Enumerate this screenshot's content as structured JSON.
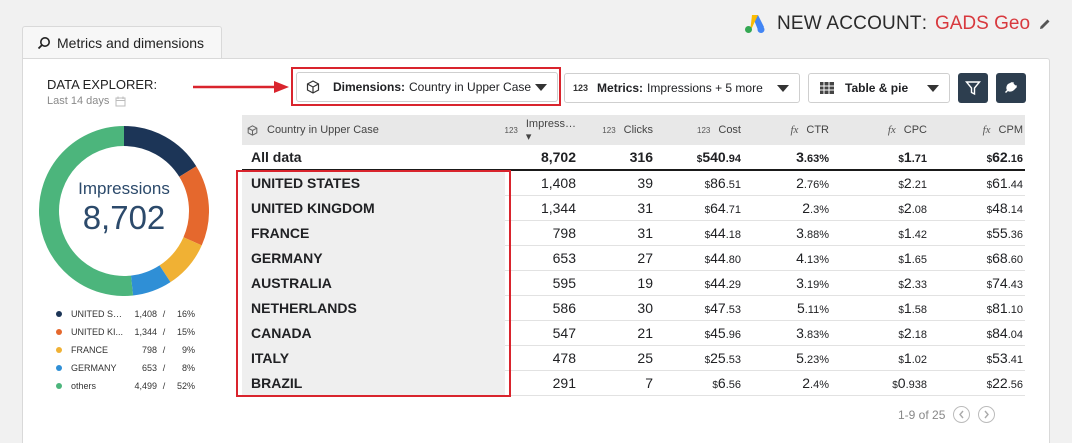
{
  "header": {
    "account_label": "NEW ACCOUNT",
    "colon": ":",
    "account_name": "GADS Geo",
    "colors": {
      "account_name": "#d8393e"
    }
  },
  "tab": {
    "label": "Metrics and dimensions"
  },
  "explorer": {
    "title": "DATA EXPLORER:",
    "date_range": "Last 14 days"
  },
  "toolbar": {
    "dimensions": {
      "prefix": "Dimensions:",
      "value": "Country in Upper Case"
    },
    "metrics": {
      "icon_text": "123",
      "prefix": "Metrics:",
      "value": "Impressions + 5 more"
    },
    "view": {
      "value": "Table & pie"
    },
    "highlight_color": "#d9242d"
  },
  "donut": {
    "label": "Impressions",
    "total": "8,702",
    "segments": [
      {
        "name": "UNITED ST...",
        "value": 1408,
        "value_text": "1,408",
        "pct": "16%",
        "color": "#1c3557"
      },
      {
        "name": "UNITED KI...",
        "value": 1344,
        "value_text": "1,344",
        "pct": "15%",
        "color": "#e5682d"
      },
      {
        "name": "FRANCE",
        "value": 798,
        "value_text": "798",
        "pct": "9%",
        "color": "#f0b134"
      },
      {
        "name": "GERMANY",
        "value": 653,
        "value_text": "653",
        "pct": "8%",
        "color": "#2f8fd6"
      },
      {
        "name": "others",
        "value": 4499,
        "value_text": "4,499",
        "pct": "52%",
        "color": "#4cb57c"
      }
    ]
  },
  "table": {
    "columns": [
      {
        "label": "Country in Upper Case",
        "prefix": ""
      },
      {
        "label": "Impress… ▾",
        "prefix": "123"
      },
      {
        "label": "Clicks",
        "prefix": "123"
      },
      {
        "label": "Cost",
        "prefix": "123"
      },
      {
        "label": "CTR",
        "prefix": "fx"
      },
      {
        "label": "CPC",
        "prefix": "fx"
      },
      {
        "label": "CPM",
        "prefix": "fx"
      }
    ],
    "total_row": {
      "name": "All data",
      "impressions": "8,702",
      "clicks": "316",
      "cost_int": "540",
      "cost_dec": ".94",
      "ctr_int": "3",
      "ctr_dec": ".63%",
      "cpc_int": "1",
      "cpc_dec": ".71",
      "cpm_int": "62",
      "cpm_dec": ".16"
    },
    "rows": [
      {
        "name": "UNITED STATES",
        "impressions": "1,408",
        "clicks": "39",
        "cost_int": "86",
        "cost_dec": ".51",
        "ctr_int": "2",
        "ctr_dec": ".76%",
        "cpc_int": "2",
        "cpc_dec": ".21",
        "cpm_int": "61",
        "cpm_dec": ".44"
      },
      {
        "name": "UNITED KINGDOM",
        "impressions": "1,344",
        "clicks": "31",
        "cost_int": "64",
        "cost_dec": ".71",
        "ctr_int": "2",
        "ctr_dec": ".3%",
        "cpc_int": "2",
        "cpc_dec": ".08",
        "cpm_int": "48",
        "cpm_dec": ".14"
      },
      {
        "name": "FRANCE",
        "impressions": "798",
        "clicks": "31",
        "cost_int": "44",
        "cost_dec": ".18",
        "ctr_int": "3",
        "ctr_dec": ".88%",
        "cpc_int": "1",
        "cpc_dec": ".42",
        "cpm_int": "55",
        "cpm_dec": ".36"
      },
      {
        "name": "GERMANY",
        "impressions": "653",
        "clicks": "27",
        "cost_int": "44",
        "cost_dec": ".80",
        "ctr_int": "4",
        "ctr_dec": ".13%",
        "cpc_int": "1",
        "cpc_dec": ".65",
        "cpm_int": "68",
        "cpm_dec": ".60"
      },
      {
        "name": "AUSTRALIA",
        "impressions": "595",
        "clicks": "19",
        "cost_int": "44",
        "cost_dec": ".29",
        "ctr_int": "3",
        "ctr_dec": ".19%",
        "cpc_int": "2",
        "cpc_dec": ".33",
        "cpm_int": "74",
        "cpm_dec": ".43"
      },
      {
        "name": "NETHERLANDS",
        "impressions": "586",
        "clicks": "30",
        "cost_int": "47",
        "cost_dec": ".53",
        "ctr_int": "5",
        "ctr_dec": ".11%",
        "cpc_int": "1",
        "cpc_dec": ".58",
        "cpm_int": "81",
        "cpm_dec": ".10"
      },
      {
        "name": "CANADA",
        "impressions": "547",
        "clicks": "21",
        "cost_int": "45",
        "cost_dec": ".96",
        "ctr_int": "3",
        "ctr_dec": ".83%",
        "cpc_int": "2",
        "cpc_dec": ".18",
        "cpm_int": "84",
        "cpm_dec": ".04"
      },
      {
        "name": "ITALY",
        "impressions": "478",
        "clicks": "25",
        "cost_int": "25",
        "cost_dec": ".53",
        "ctr_int": "5",
        "ctr_dec": ".23%",
        "cpc_int": "1",
        "cpc_dec": ".02",
        "cpm_int": "53",
        "cpm_dec": ".41"
      },
      {
        "name": "BRAZIL",
        "impressions": "291",
        "clicks": "7",
        "cost_int": "6",
        "cost_dec": ".56",
        "ctr_int": "2",
        "ctr_dec": ".4%",
        "cpc_int": "0",
        "cpc_dec": ".938",
        "cpm_int": "22",
        "cpm_dec": ".56"
      }
    ],
    "currency_symbol": "$"
  },
  "pager": {
    "text": "1-9 of 25"
  }
}
